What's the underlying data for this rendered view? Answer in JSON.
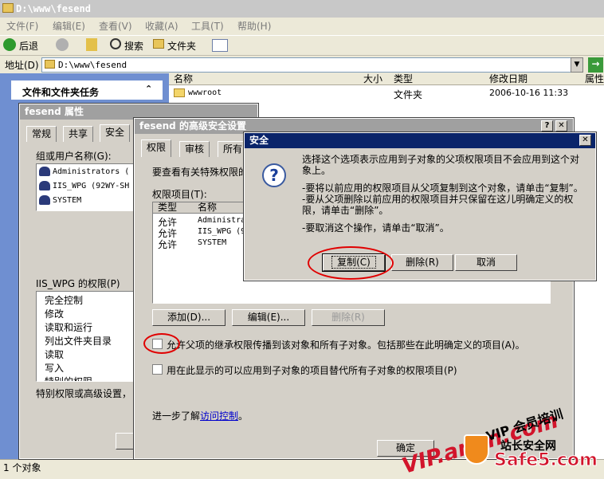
{
  "window": {
    "title": "D:\\www\\fesend",
    "address_label": "地址(D)",
    "address_value": "D:\\www\\fesend"
  },
  "menu": [
    "文件(F)",
    "编辑(E)",
    "查看(V)",
    "收藏(A)",
    "工具(T)",
    "帮助(H)"
  ],
  "toolbar": {
    "back": "后退",
    "search": "搜索",
    "folders": "文件夹"
  },
  "left_pane": {
    "tasks_title": "文件和文件夹任务"
  },
  "list": {
    "headers": {
      "name": "名称",
      "size": "大小",
      "type": "类型",
      "modified": "修改日期",
      "attrs": "属性"
    },
    "rows": [
      {
        "name": "wwwroot",
        "type": "文件夹",
        "modified": "2006-10-16 11:33"
      }
    ]
  },
  "status": "1 个对象",
  "props": {
    "title": "fesend 属性",
    "tabs": [
      "常规",
      "共享",
      "安全"
    ],
    "group_label": "组或用户名称(G):",
    "users": [
      "Administrators (",
      "IIS_WPG (92WY-SH",
      "SYSTEM"
    ],
    "perm_label": "IIS_WPG 的权限(P)",
    "perms": [
      "完全控制",
      "修改",
      "读取和运行",
      "列出文件夹目录",
      "读取",
      "写入",
      "特别的权限"
    ],
    "adv_text": "特别权限或高级设置，"
  },
  "adv": {
    "title": "fesend 的高级安全设置",
    "tabs": [
      "权限",
      "审核",
      "所有"
    ],
    "desc": "要查看有关特殊权限的",
    "entries_label": "权限项目(T):",
    "col_type": "类型",
    "col_name": "名称",
    "entries": [
      {
        "type": "允许",
        "name": "Administrators"
      },
      {
        "type": "允许",
        "name": "IIS_WPG (9"
      },
      {
        "type": "允许",
        "name": "SYSTEM"
      }
    ],
    "add": "添加(D)...",
    "edit": "编辑(E)...",
    "remove": "删除(R)",
    "inherit_text": "允许父项的继承权限传播到该对象和所有子对象。包括那些在此明确定义的项目(A)。",
    "replace_text": "用在此显示的可以应用到子对象的项目替代所有子对象的权限项目(P)",
    "learn_prefix": "进一步了解",
    "learn_link": "访问控制",
    "learn_suffix": "。",
    "ok": "确定"
  },
  "security": {
    "title": "安全",
    "line1": "选择这个选项表示应用到子对象的父项权限项目不会应用到这个对象上。",
    "line2": "-要将以前应用的权限项目从父项复制到这个对象，请单击“复制”。",
    "line3": "-要从父项删除以前应用的权限项目并只保留在这儿明确定义的权限，请单击“删除”。",
    "line4": "-要取消这个操作，请单击“取消”。",
    "copy": "复制(C)",
    "remove": "删除(R)",
    "cancel": "取消"
  },
  "watermarks": {
    "w1": "VIP.anqn.com",
    "w2": "VIP 会员培训",
    "w3": "站长安全网",
    "w4": "Safe5.com"
  }
}
